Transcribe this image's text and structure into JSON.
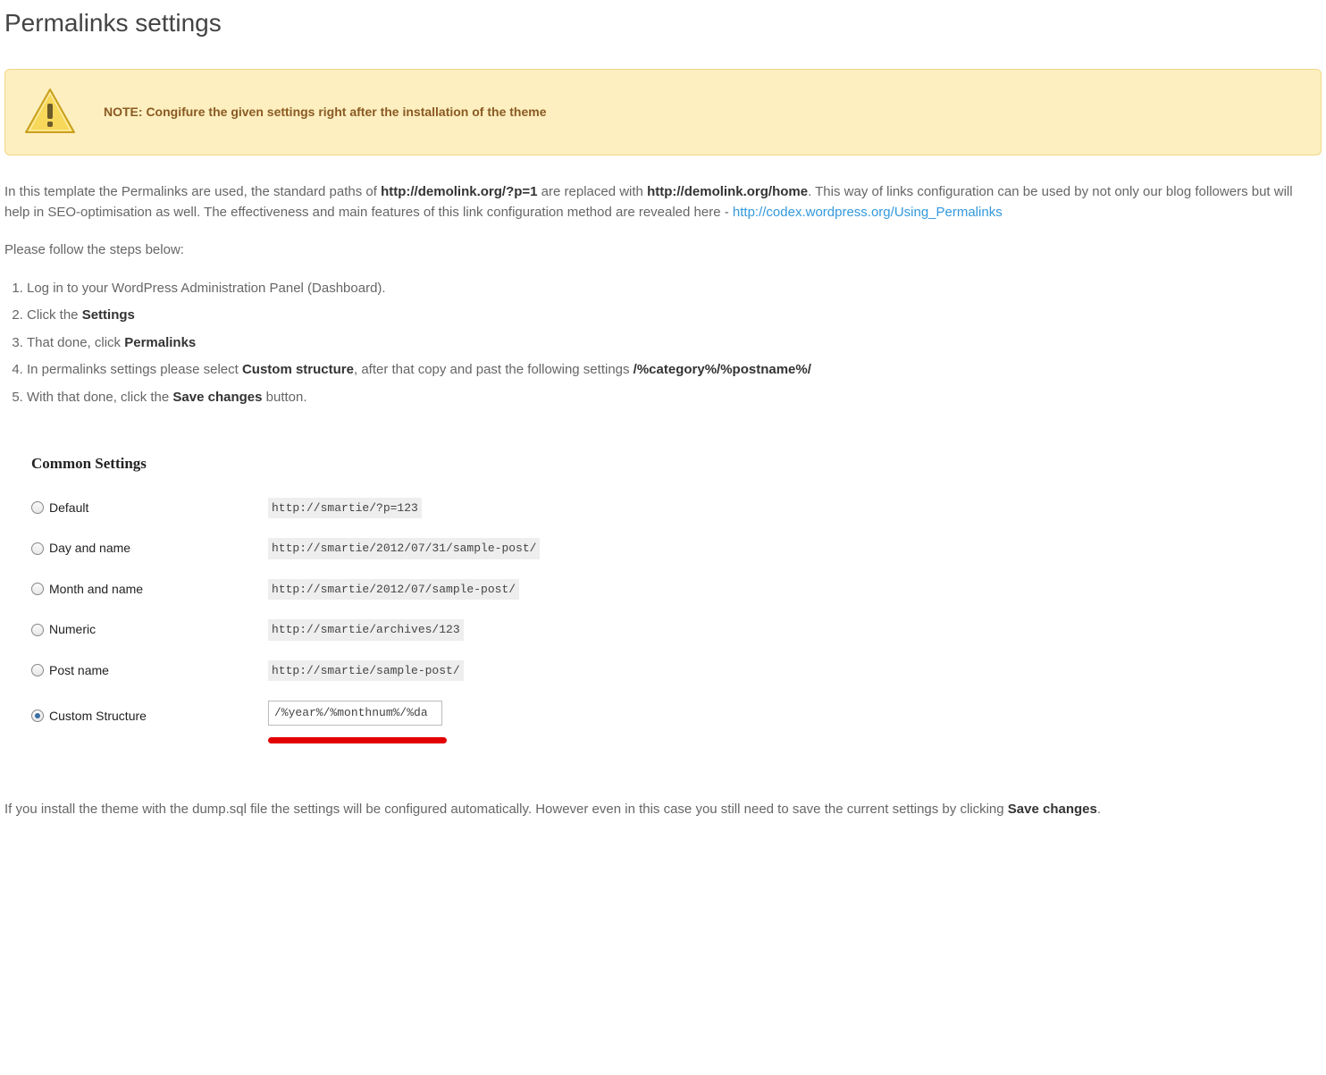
{
  "title": "Permalinks settings",
  "note": {
    "text": "NOTE: Congifure the given settings right after the installation of the theme"
  },
  "intro": {
    "part1": "In this template the Permalinks are used, the standard paths of ",
    "url1": "http://demolink.org/?p=1",
    "part2": " are replaced with ",
    "url2": "http://demolink.org/home",
    "part3": ". This way of links configuration can be used by not only our blog followers but will help in SEO-optimisation as well. The effectiveness and main features of this link configuration method are revealed here - ",
    "link_text": "http://codex.wordpress.org/Using_Permalinks"
  },
  "follow": "Please follow the steps below:",
  "steps": {
    "s1": "Log in to your WordPress Administration Panel (Dashboard).",
    "s2a": "Click the ",
    "s2b": "Settings",
    "s3a": "That done, click ",
    "s3b": "Permalinks",
    "s4a": "In permalinks settings please select ",
    "s4b": "Custom structure",
    "s4c": ", after that copy and past the following settings ",
    "s4d": "/%category%/%postname%/",
    "s5a": "With that done, click the ",
    "s5b": "Save changes",
    "s5c": " button."
  },
  "screenshot": {
    "heading": "Common Settings",
    "rows": [
      {
        "label": "Default",
        "value": "http://smartie/?p=123"
      },
      {
        "label": "Day and name",
        "value": "http://smartie/2012/07/31/sample-post/"
      },
      {
        "label": "Month and name",
        "value": "http://smartie/2012/07/sample-post/"
      },
      {
        "label": "Numeric",
        "value": "http://smartie/archives/123"
      },
      {
        "label": "Post name",
        "value": "http://smartie/sample-post/"
      }
    ],
    "custom": {
      "label": "Custom Structure",
      "value": "/%year%/%monthnum%/%da"
    }
  },
  "outro": {
    "part1": "If you install the theme with the dump.sql file the settings will be configured automatically. However even in this case you still need to save the current settings by clicking ",
    "strong": "Save changes",
    "part2": "."
  }
}
